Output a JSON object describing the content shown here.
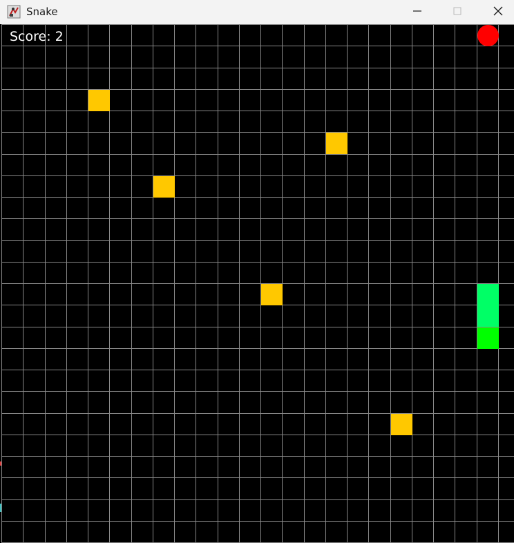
{
  "window": {
    "title": "Snake",
    "controls": [
      "minimize",
      "maximize",
      "close"
    ]
  },
  "game": {
    "score_label": "Score:",
    "score_value": "2",
    "grid_columns": 24,
    "grid_rows": 24,
    "background_color": "#000000",
    "grid_line_color": "#8a8a8a",
    "food_color": "#ffc800",
    "apple_color": "#ff0000",
    "snake_body_color": "#00ff66",
    "snake_head_color": "#00ff00",
    "food_cells": [
      {
        "col": 4,
        "row": 3
      },
      {
        "col": 15,
        "row": 5
      },
      {
        "col": 7,
        "row": 7
      },
      {
        "col": 12,
        "row": 12
      },
      {
        "col": 18,
        "row": 18
      }
    ],
    "apple_cell": {
      "col": 22,
      "row": 0
    },
    "snake_cells": [
      {
        "col": 22,
        "row": 12,
        "part": "body"
      },
      {
        "col": 22,
        "row": 13,
        "part": "body"
      },
      {
        "col": 22,
        "row": 14,
        "part": "head"
      }
    ]
  }
}
